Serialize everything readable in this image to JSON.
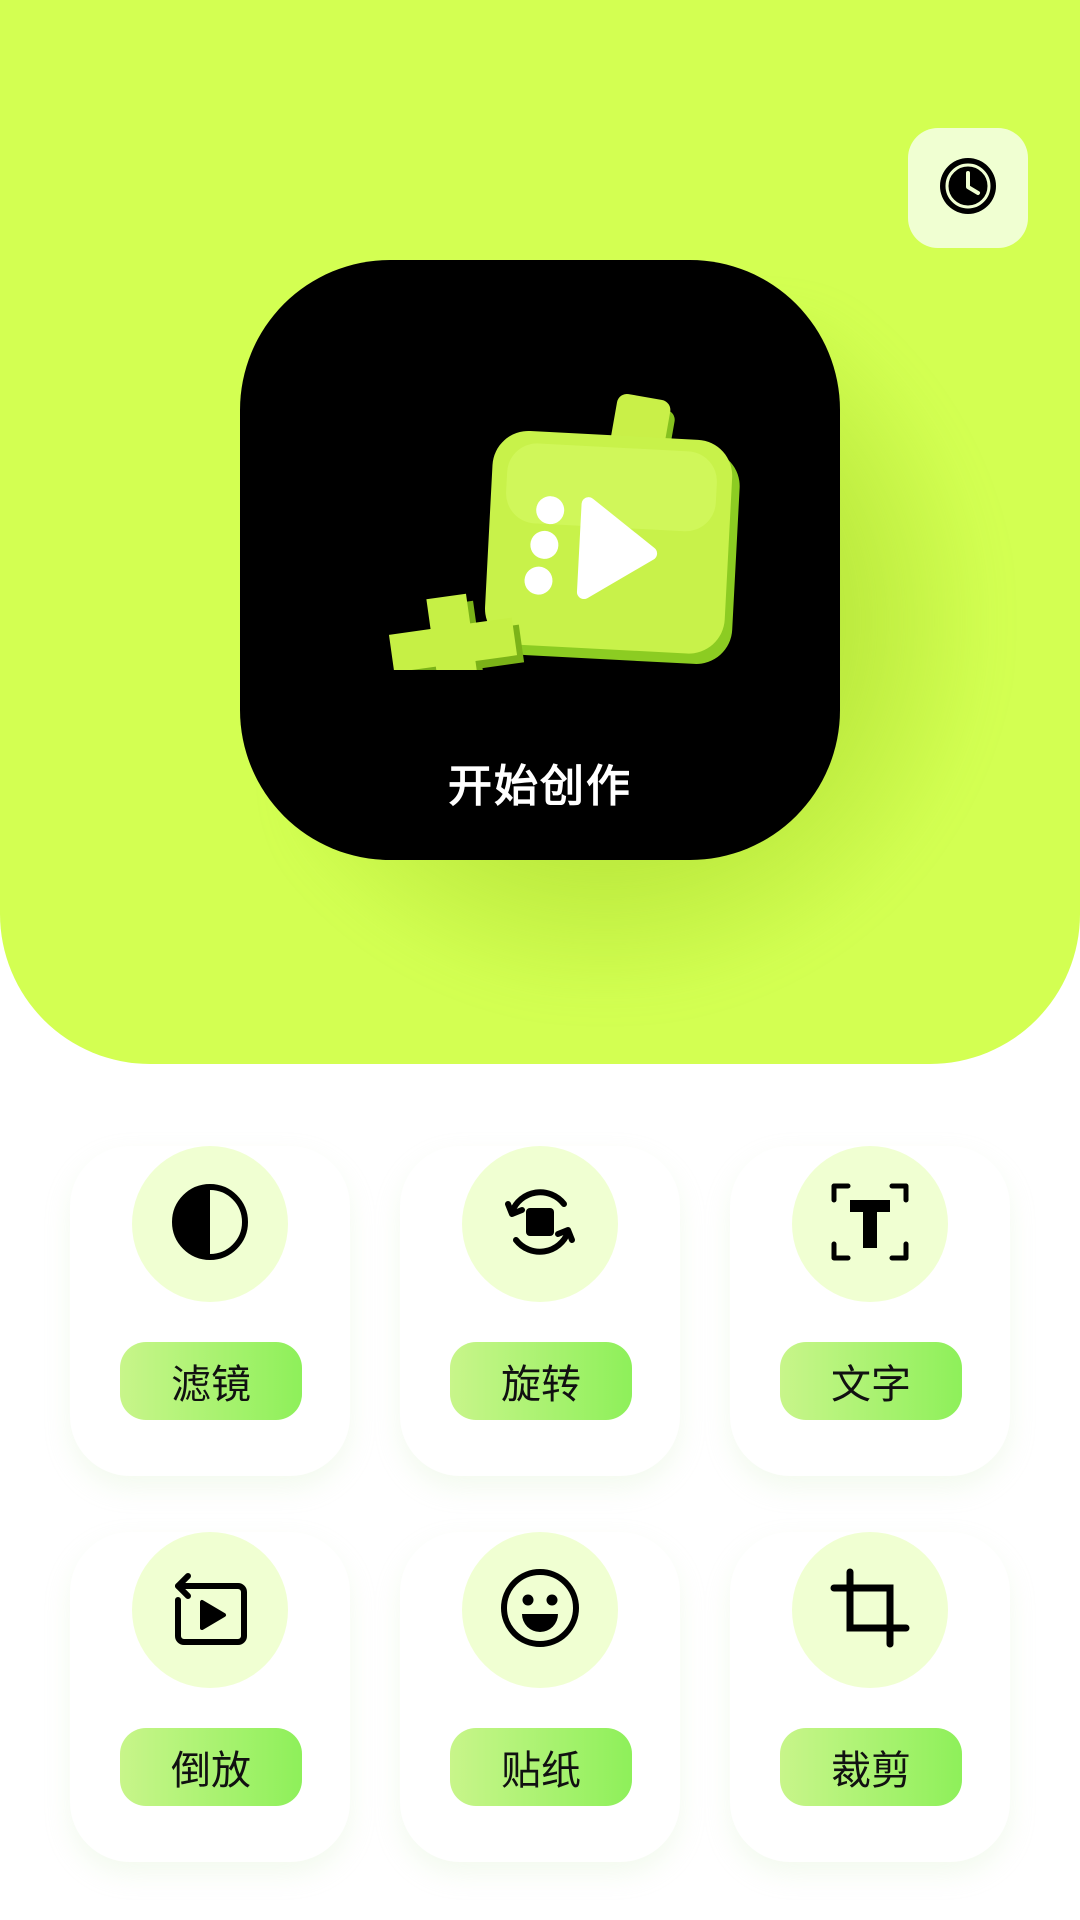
{
  "colors": {
    "hero_bg": "#d3ff52",
    "card_bg": "#000000",
    "icon_circle_bg": "#f0ffd2",
    "pill_gradient_start": "#c8f58a",
    "pill_gradient_end": "#8ef05a"
  },
  "header": {
    "history_icon": "clock-icon"
  },
  "hero": {
    "create_label": "开始创作",
    "illustration": "video-plus-illustration"
  },
  "tools": [
    {
      "label": "滤镜",
      "icon": "filter-half-circle-icon"
    },
    {
      "label": "旋转",
      "icon": "rotate-icon"
    },
    {
      "label": "文字",
      "icon": "text-icon"
    },
    {
      "label": "倒放",
      "icon": "reverse-play-icon"
    },
    {
      "label": "贴纸",
      "icon": "smiley-sticker-icon"
    },
    {
      "label": "裁剪",
      "icon": "crop-icon"
    }
  ]
}
